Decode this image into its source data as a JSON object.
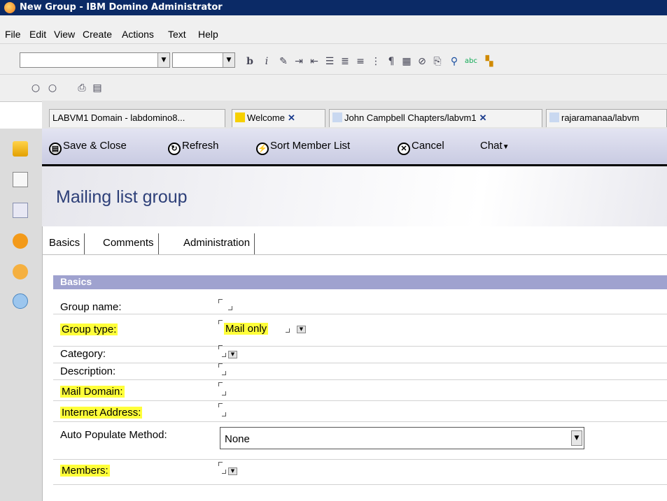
{
  "window": {
    "title": "New Group - IBM Domino Administrator"
  },
  "menu": [
    "File",
    "Edit",
    "View",
    "Create",
    "Actions",
    "Text",
    "Help"
  ],
  "tabs": [
    {
      "label": "LABVM1 Domain - labdomino8...",
      "closable": false
    },
    {
      "label": "Welcome",
      "closable": true
    },
    {
      "label": "John Campbell Chapters/labvm1",
      "closable": true
    },
    {
      "label": "rajaramanaa/labvm",
      "closable": false
    }
  ],
  "actions": {
    "save_close": "Save & Close",
    "refresh": "Refresh",
    "sort_members": "Sort Member List",
    "cancel": "Cancel",
    "chat": "Chat"
  },
  "form": {
    "title": "Mailing list group",
    "tabs": [
      "Basics",
      "Comments",
      "Administration"
    ],
    "section": "Basics",
    "fields": {
      "group_name": {
        "label": "Group name:"
      },
      "group_type": {
        "label": "Group type:",
        "value": "Mail only"
      },
      "category": {
        "label": "Category:"
      },
      "description": {
        "label": "Description:"
      },
      "mail_domain": {
        "label": "Mail Domain:"
      },
      "internet_address": {
        "label": "Internet Address:"
      },
      "auto_populate": {
        "label": "Auto Populate Method:",
        "value": "None"
      },
      "members": {
        "label": "Members:"
      }
    }
  },
  "colors": {
    "titlebar": "#0b2a66",
    "highlight": "#ffff3a",
    "section_header": "#9fa2cf",
    "form_title": "#2d3f78"
  },
  "icons": [
    "app-logo-icon",
    "bold-icon",
    "italic-icon",
    "pen-icon",
    "indent-icon",
    "bullets-icon",
    "numbering-icon",
    "align-icon",
    "table-icon",
    "link-icon",
    "attachment-icon",
    "search-icon",
    "spellcheck-icon",
    "ruler-icon",
    "zoom-in-icon",
    "zoom-out-icon",
    "printer-icon",
    "save-icon",
    "folder-icon",
    "document-icon",
    "replica-icon",
    "people-icon",
    "compass-icon",
    "chat-bubble-icon"
  ]
}
